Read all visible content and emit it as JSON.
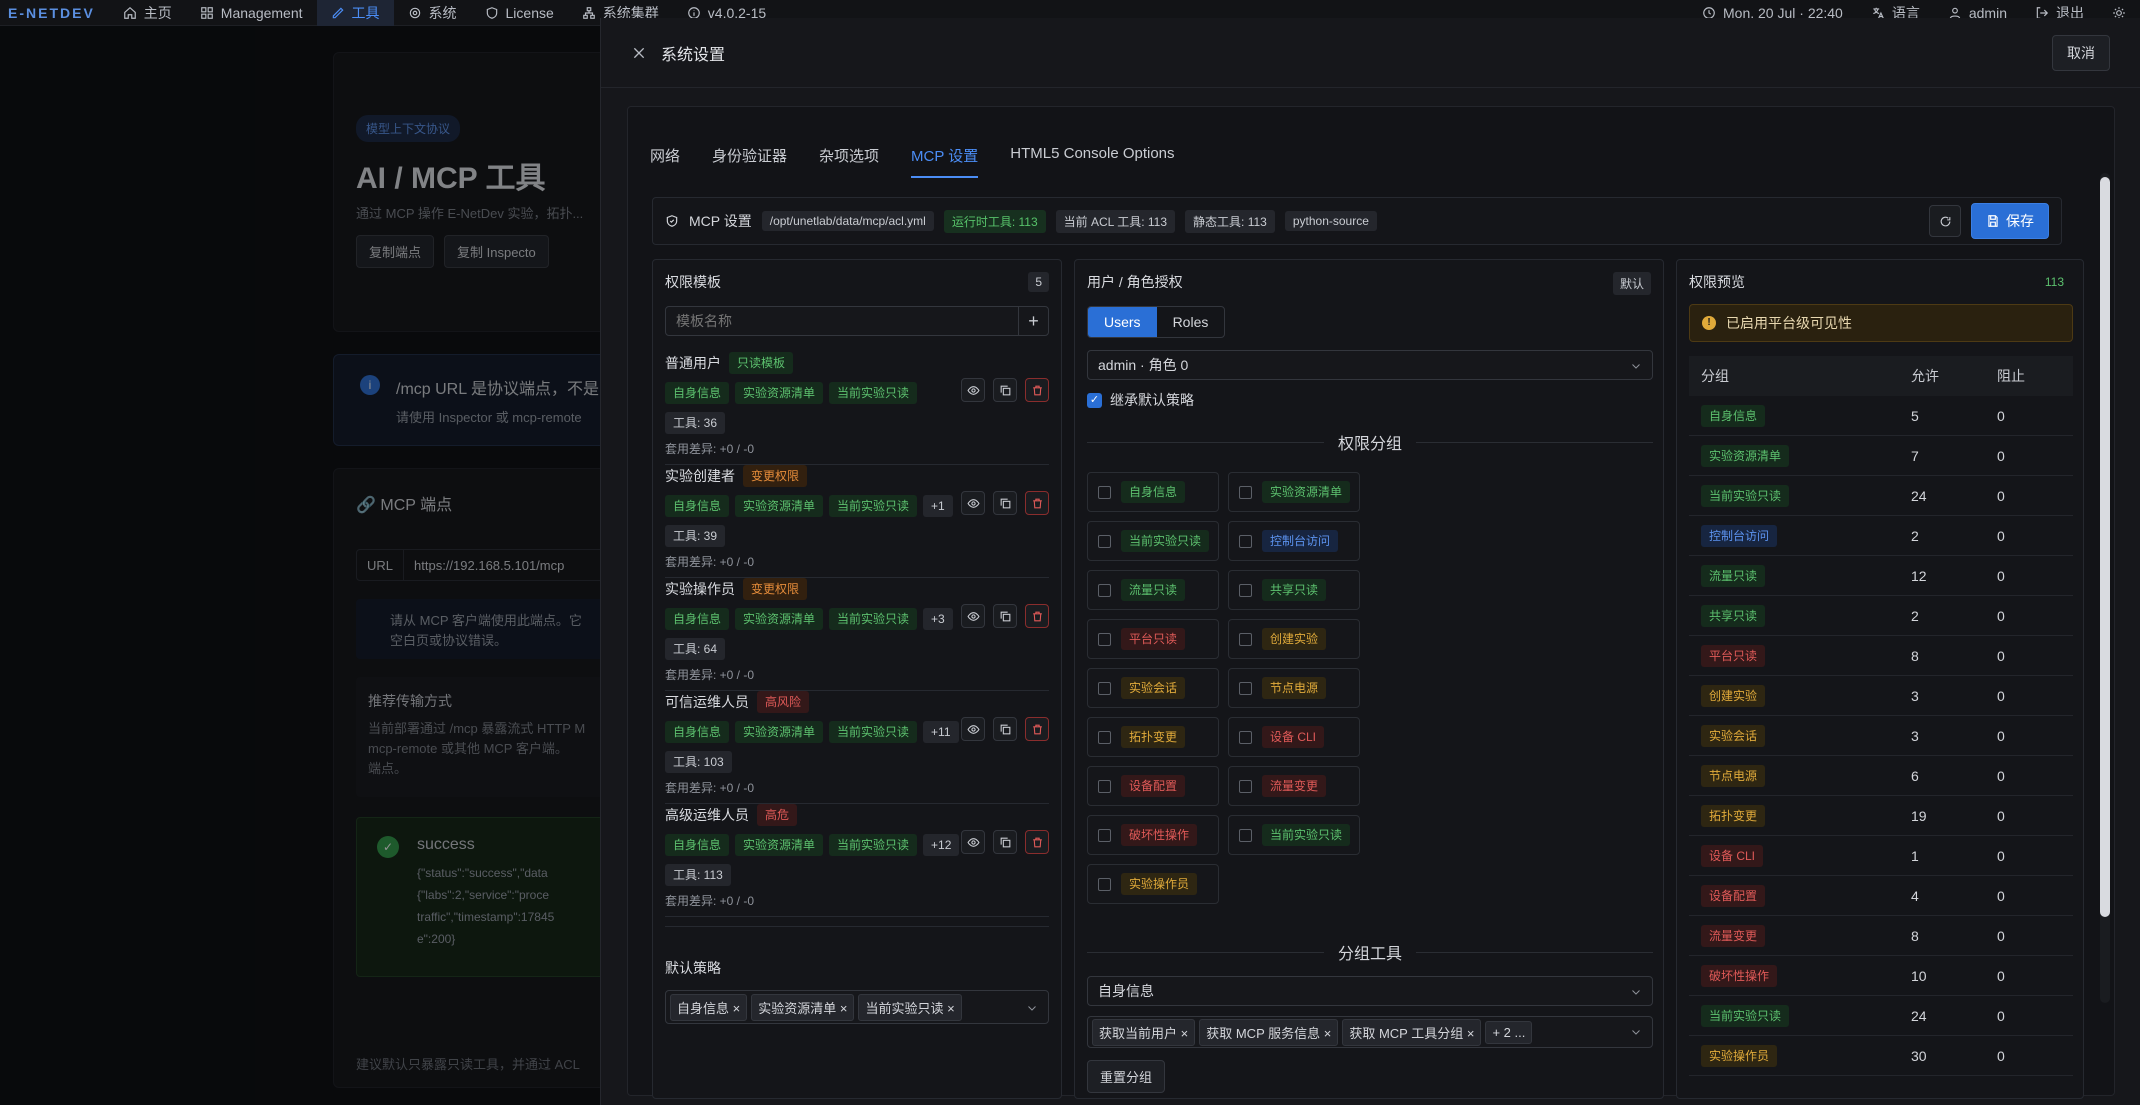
{
  "nav": {
    "brand": "E-NETDEV",
    "items": [
      {
        "label": "主页",
        "icon": "home-icon"
      },
      {
        "label": "Management",
        "icon": "grid-icon"
      },
      {
        "label": "工具",
        "icon": "tool-icon"
      },
      {
        "label": "系统",
        "icon": "gear-icon"
      },
      {
        "label": "License",
        "icon": "shield-icon"
      },
      {
        "label": "系统集群",
        "icon": "cluster-icon"
      },
      {
        "label": "v4.0.2-15",
        "icon": "info-icon"
      }
    ],
    "datetime": "Mon, 20 Jul · 22:40",
    "language": "语言",
    "user": "admin",
    "logout": "退出"
  },
  "background": {
    "badge": "模型上下文协议",
    "title": "AI / MCP 工具",
    "subtitle": "通过 MCP 操作 E-NetDev 实验，拓扑...",
    "copy_endpoint": "复制端点",
    "copy_inspector": "复制 Inspecto",
    "notice_title": "/mcp URL 是协议端点，不是",
    "notice_body": "请使用 Inspector 或 mcp-remote",
    "endpoint_title": "MCP 端点",
    "url_label": "URL",
    "url_value": "https://192.168.5.101/mcp",
    "client_notice_1": "请从 MCP 客户端使用此端点。它",
    "client_notice_2": "空白页或协议错误。",
    "transport_title": "推荐传输方式",
    "transport_body_1": "当前部署通过 /mcp 暴露流式 HTTP M",
    "transport_body_2": "mcp-remote 或其他 MCP 客户端。",
    "transport_body_3": "端点。",
    "success_title": "success",
    "success_json_1": "{\"status\":\"success\",\"data",
    "success_json_2": "{\"labs\":2,\"service\":\"proce",
    "success_json_3": "traffic\",\"timestamp\":17845",
    "success_json_4": "e\":200}",
    "footer": "建议默认只暴露只读工具，并通过 ACL"
  },
  "modal": {
    "title": "系统设置",
    "cancel": "取消",
    "tabs": [
      "网络",
      "身份验证器",
      "杂项选项",
      "MCP 设置",
      "HTML5 Console Options"
    ],
    "infobar": {
      "label": "MCP 设置",
      "path": "/opt/unetlab/data/mcp/acl.yml",
      "runtime_tools": "运行时工具: 113",
      "acl_tools": "当前 ACL 工具: 113",
      "static_tools": "静态工具: 113",
      "source": "python-source",
      "save": "保存"
    },
    "templates": {
      "title": "权限模板",
      "count": "5",
      "placeholder": "模板名称",
      "items": [
        {
          "name": "普通用户",
          "badge": "只读模板",
          "badge_color": "g",
          "tags": [
            "自身信息",
            "实验资源清单",
            "当前实验只读"
          ],
          "more": "",
          "tools": "工具: 36",
          "diff": "套用差异: +0 / -0"
        },
        {
          "name": "实验创建者",
          "badge": "变更权限",
          "badge_color": "o",
          "tags": [
            "自身信息",
            "实验资源清单",
            "当前实验只读"
          ],
          "more": "+1",
          "tools": "工具: 39",
          "diff": "套用差异: +0 / -0"
        },
        {
          "name": "实验操作员",
          "badge": "变更权限",
          "badge_color": "o",
          "tags": [
            "自身信息",
            "实验资源清单",
            "当前实验只读"
          ],
          "more": "+3",
          "tools": "工具: 64",
          "diff": "套用差异: +0 / -0"
        },
        {
          "name": "可信运维人员",
          "badge": "高风险",
          "badge_color": "r",
          "tags": [
            "自身信息",
            "实验资源清单",
            "当前实验只读"
          ],
          "more": "+11",
          "tools": "工具: 103",
          "diff": "套用差异: +0 / -0"
        },
        {
          "name": "高级运维人员",
          "badge": "高危",
          "badge_color": "r",
          "tags": [
            "自身信息",
            "实验资源清单",
            "当前实验只读"
          ],
          "more": "+12",
          "tools": "工具: 113",
          "diff": "套用差异: +0 / -0"
        }
      ],
      "default_policy_title": "默认策略",
      "default_policy": [
        "自身信息",
        "实验资源清单",
        "当前实验只读"
      ]
    },
    "roles": {
      "title": "用户 / 角色授权",
      "default_badge": "默认",
      "toggle": [
        "Users",
        "Roles"
      ],
      "selected_user": "admin · 角色 0",
      "inherit": "继承默认策略",
      "groups_title": "权限分组",
      "groups": [
        {
          "label": "自身信息",
          "color": "g"
        },
        {
          "label": "实验资源清单",
          "color": "g"
        },
        {
          "label": "当前实验只读",
          "color": "g"
        },
        {
          "label": "控制台访问",
          "color": "b"
        },
        {
          "label": "流量只读",
          "color": "g"
        },
        {
          "label": "共享只读",
          "color": "g"
        },
        {
          "label": "平台只读",
          "color": "r"
        },
        {
          "label": "创建实验",
          "color": "y"
        },
        {
          "label": "实验会话",
          "color": "y"
        },
        {
          "label": "节点电源",
          "color": "y"
        },
        {
          "label": "拓扑变更",
          "color": "y"
        },
        {
          "label": "设备 CLI",
          "color": "r"
        },
        {
          "label": "设备配置",
          "color": "r"
        },
        {
          "label": "流量变更",
          "color": "r"
        },
        {
          "label": "破坏性操作",
          "color": "r"
        },
        {
          "label": "当前实验只读",
          "color": "g"
        },
        {
          "label": "实验操作员",
          "color": "y"
        }
      ],
      "tools_title": "分组工具",
      "tools_group": "自身信息",
      "tools_selected": [
        "获取当前用户",
        "获取 MCP 服务信息",
        "获取 MCP 工具分组"
      ],
      "tools_more": "+ 2 ...",
      "reset": "重置分组"
    },
    "preview": {
      "title": "权限预览",
      "count": "113",
      "warning": "已启用平台级可见性",
      "headers": [
        "分组",
        "允许",
        "阻止"
      ],
      "rows": [
        {
          "group": "自身信息",
          "color": "g",
          "allow": "5",
          "block": "0"
        },
        {
          "group": "实验资源清单",
          "color": "g",
          "allow": "7",
          "block": "0"
        },
        {
          "group": "当前实验只读",
          "color": "g",
          "allow": "24",
          "block": "0"
        },
        {
          "group": "控制台访问",
          "color": "b",
          "allow": "2",
          "block": "0"
        },
        {
          "group": "流量只读",
          "color": "g",
          "allow": "12",
          "block": "0"
        },
        {
          "group": "共享只读",
          "color": "g",
          "allow": "2",
          "block": "0"
        },
        {
          "group": "平台只读",
          "color": "r",
          "allow": "8",
          "block": "0"
        },
        {
          "group": "创建实验",
          "color": "y",
          "allow": "3",
          "block": "0"
        },
        {
          "group": "实验会话",
          "color": "y",
          "allow": "3",
          "block": "0"
        },
        {
          "group": "节点电源",
          "color": "y",
          "allow": "6",
          "block": "0"
        },
        {
          "group": "拓扑变更",
          "color": "y",
          "allow": "19",
          "block": "0"
        },
        {
          "group": "设备 CLI",
          "color": "r",
          "allow": "1",
          "block": "0"
        },
        {
          "group": "设备配置",
          "color": "r",
          "allow": "4",
          "block": "0"
        },
        {
          "group": "流量变更",
          "color": "r",
          "allow": "8",
          "block": "0"
        },
        {
          "group": "破坏性操作",
          "color": "r",
          "allow": "10",
          "block": "0"
        },
        {
          "group": "当前实验只读",
          "color": "g",
          "allow": "24",
          "block": "0"
        },
        {
          "group": "实验操作员",
          "color": "y",
          "allow": "30",
          "block": "0"
        }
      ]
    }
  }
}
